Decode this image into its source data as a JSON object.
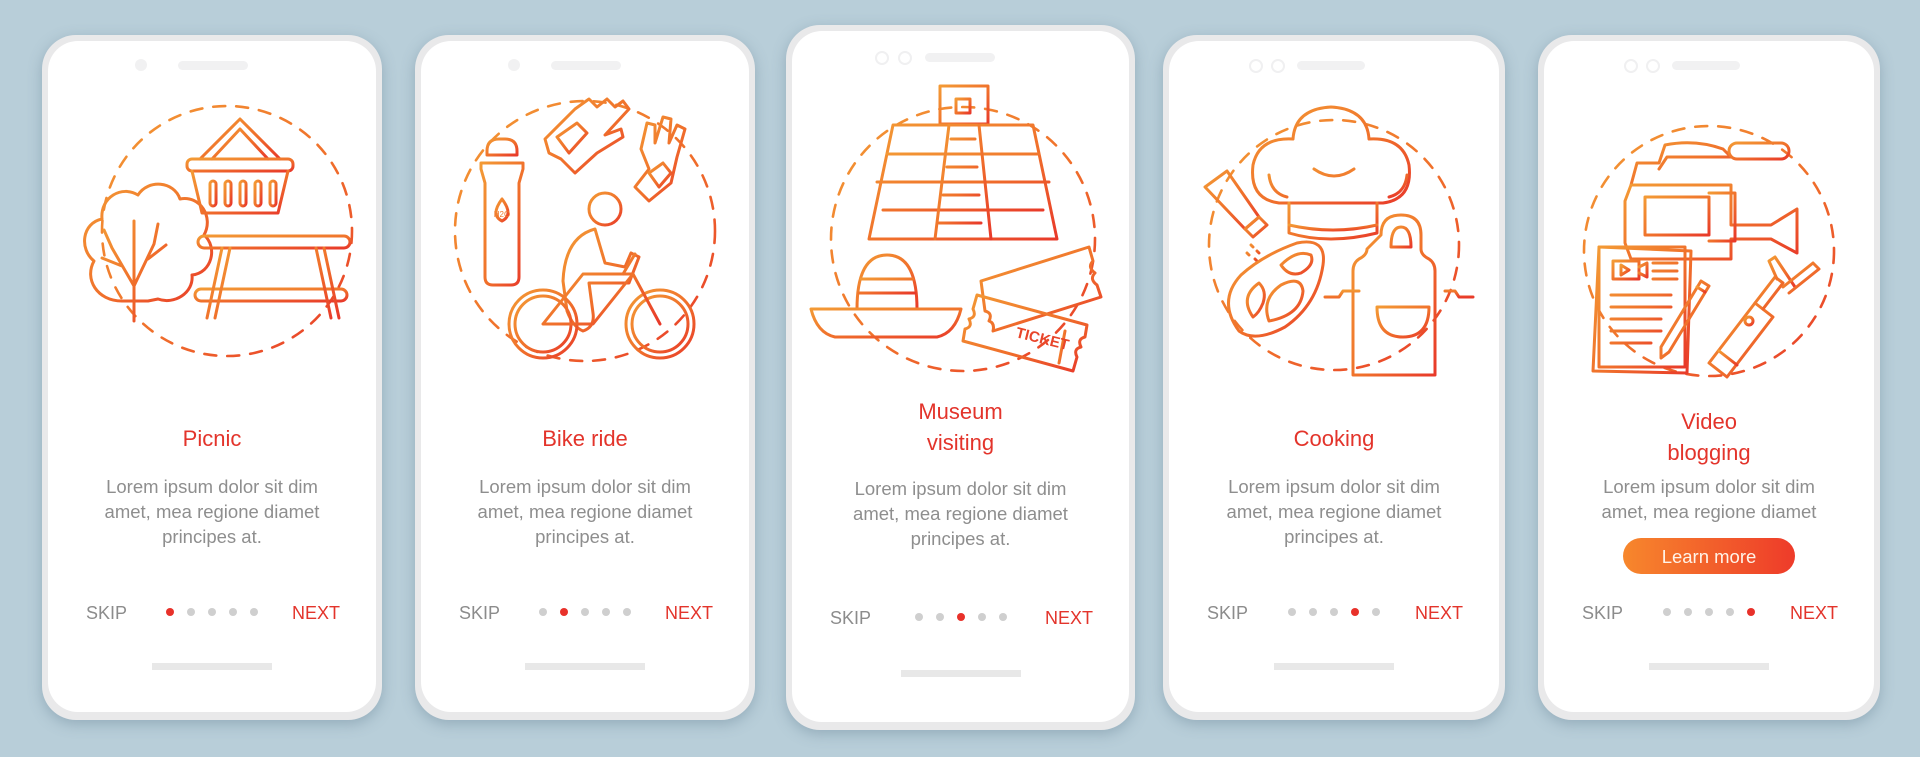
{
  "colors": {
    "background": "#B8CED9",
    "accent": "#E3342B",
    "gradient_start": "#F7872C",
    "gradient_end": "#EE3B2A",
    "body_text": "#8E8E8E",
    "inactive_dot": "#CFCFCF"
  },
  "screens": [
    {
      "id": "picnic",
      "title_lines": [
        "Picnic"
      ],
      "body_lines": [
        "Lorem ipsum dolor sit dim",
        "amet, mea regione diamet",
        "principes at."
      ],
      "skip_label": "SKIP",
      "next_label": "NEXT",
      "page_count": 5,
      "active_page": 1,
      "illustration_icons": [
        "tree-icon",
        "picnic-basket-icon",
        "picnic-table-icon"
      ]
    },
    {
      "id": "bike-ride",
      "title_lines": [
        "Bike ride"
      ],
      "body_lines": [
        "Lorem ipsum dolor sit dim",
        "amet, mea regione diamet",
        "principes at."
      ],
      "skip_label": "SKIP",
      "next_label": "NEXT",
      "page_count": 5,
      "active_page": 2,
      "illustration_icons": [
        "water-bottle-icon",
        "gloves-icon",
        "cyclist-icon"
      ],
      "bottle_label": "H2O"
    },
    {
      "id": "museum-visiting",
      "title_lines": [
        "Museum",
        "visiting"
      ],
      "body_lines": [
        "Lorem ipsum dolor sit dim",
        "amet, mea regione diamet",
        "principes at."
      ],
      "skip_label": "SKIP",
      "next_label": "NEXT",
      "page_count": 5,
      "active_page": 3,
      "illustration_icons": [
        "pyramid-icon",
        "sombrero-icon",
        "tickets-icon"
      ],
      "ticket_label": "TICKET"
    },
    {
      "id": "cooking",
      "title_lines": [
        "Cooking"
      ],
      "body_lines": [
        "Lorem ipsum dolor sit dim",
        "amet, mea regione diamet",
        "principes at."
      ],
      "skip_label": "SKIP",
      "next_label": "NEXT",
      "page_count": 5,
      "active_page": 4,
      "illustration_icons": [
        "chef-hat-icon",
        "salt-shaker-icon",
        "steak-icon",
        "apron-icon"
      ]
    },
    {
      "id": "video-blogging",
      "title_lines": [
        "Video",
        "blogging"
      ],
      "body_lines": [
        "Lorem ipsum dolor sit dim",
        "amet, mea regione diamet"
      ],
      "cta_label": "Learn more",
      "skip_label": "SKIP",
      "next_label": "NEXT",
      "page_count": 5,
      "active_page": 5,
      "illustration_icons": [
        "video-camera-icon",
        "document-icon",
        "pencil-icon",
        "selfie-stick-icon"
      ]
    }
  ]
}
